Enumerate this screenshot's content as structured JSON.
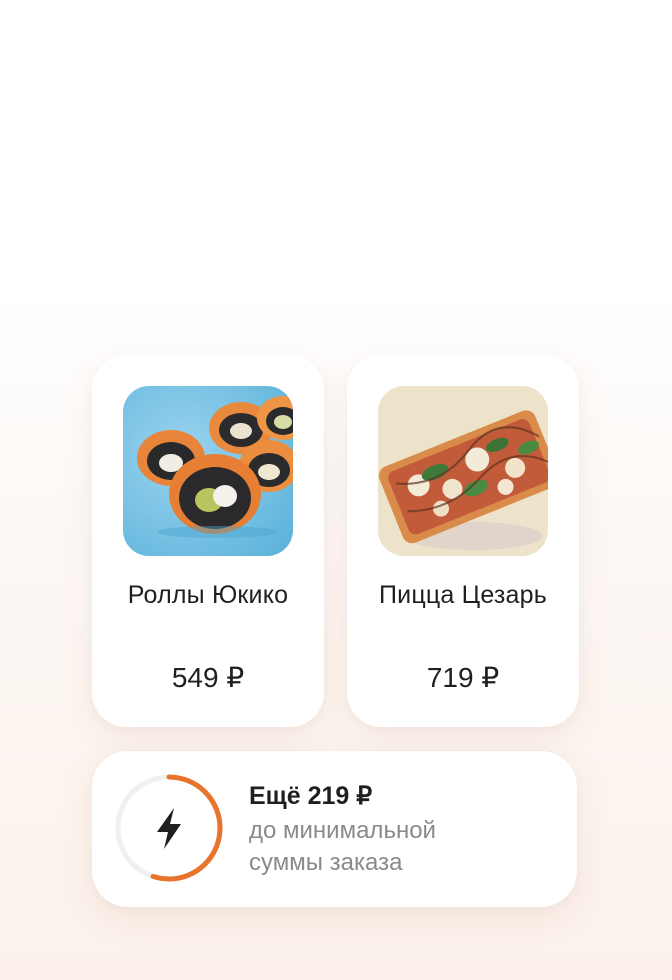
{
  "products": [
    {
      "name": "Роллы Юкико",
      "price": "549 ₽",
      "image": "rolls-photo"
    },
    {
      "name": "Пицца Цезарь",
      "price": "719 ₽",
      "image": "pizza-photo"
    }
  ],
  "min_order": {
    "title": "Ещё 219 ₽",
    "subtitle_line1": "до минимальной",
    "subtitle_line2": "суммы заказа",
    "icon": "lightning-icon",
    "progress": 0.55
  },
  "colors": {
    "accent": "#E8732A",
    "ring_track": "#F0F0F0",
    "text": "#1F1F1F",
    "muted_text": "#8A8A8A",
    "rolls_background": "#7FC3E3",
    "pizza_background": "#EDE3CA"
  }
}
